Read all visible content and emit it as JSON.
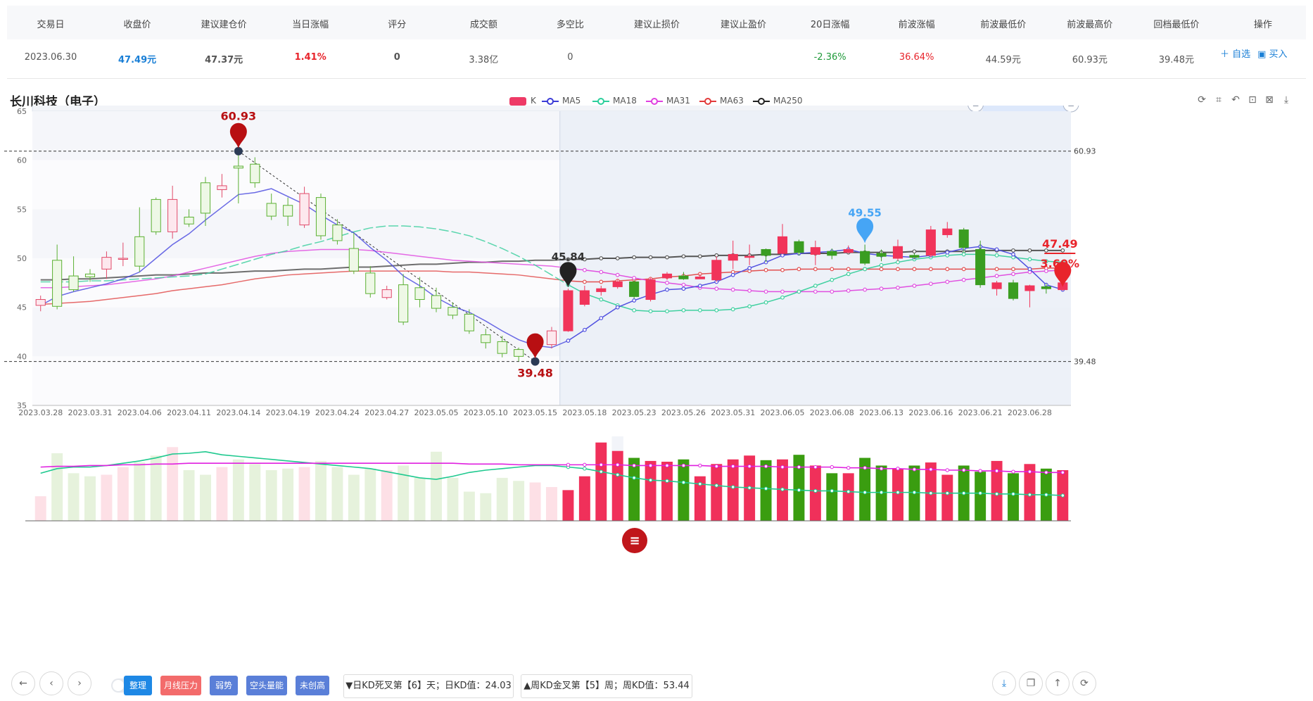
{
  "summary": {
    "headers": [
      "交易日",
      "收盘价",
      "建议建仓价",
      "当日涨幅",
      "评分",
      "成交额",
      "多空比",
      "建议止损价",
      "建议止盈价",
      "20日涨幅",
      "前波涨幅",
      "前波最低价",
      "前波最高价",
      "回档最低价",
      "操作"
    ],
    "values": [
      "2023.06.30",
      "47.49元",
      "47.37元",
      "1.41%",
      "0",
      "3.38亿",
      "0",
      "",
      "",
      "-2.36%",
      "36.64%",
      "44.59元",
      "60.93元",
      "39.48元"
    ],
    "ops": [
      "＋ 自选",
      "▣ 买入"
    ]
  },
  "stock_title": "长川科技（电子）",
  "legend": [
    {
      "name": "K",
      "color": "#ee3a66"
    },
    {
      "name": "MA5",
      "color": "#3b3bd6"
    },
    {
      "name": "MA18",
      "color": "#2ccf9c"
    },
    {
      "name": "MA31",
      "color": "#e040e0"
    },
    {
      "name": "MA63",
      "color": "#e23a3a"
    },
    {
      "name": "MA250",
      "color": "#222222"
    }
  ],
  "toolbox_icons": [
    "refresh-icon",
    "crop-icon",
    "undo-icon",
    "zoom-icon",
    "close-icon",
    "download-icon"
  ],
  "chart_data": {
    "type": "candlestick",
    "title": "长川科技（电子）",
    "ylim": [
      35,
      65
    ],
    "yticks": [
      35,
      40,
      45,
      50,
      55,
      60,
      65
    ],
    "x_labels": [
      "2023.03.28",
      "2023.03.31",
      "2023.04.06",
      "2023.04.11",
      "2023.04.14",
      "2023.04.19",
      "2023.04.24",
      "2023.04.27",
      "2023.05.05",
      "2023.05.10",
      "2023.05.15",
      "2023.05.18",
      "2023.05.23",
      "2023.05.26",
      "2023.05.31",
      "2023.06.05",
      "2023.06.08",
      "2023.06.13",
      "2023.06.16",
      "2023.06.21",
      "2023.06.28"
    ],
    "ohlc": [
      [
        45.2,
        45.8,
        44.6,
        46.2
      ],
      [
        49.8,
        45.1,
        44.8,
        51.4
      ],
      [
        48.2,
        46.8,
        46.6,
        50.2
      ],
      [
        48.4,
        48.1,
        47.6,
        48.9
      ],
      [
        48.9,
        50.1,
        47.9,
        50.7
      ],
      [
        50.0,
        50.0,
        49.2,
        51.6
      ],
      [
        52.2,
        49.2,
        48.6,
        55.2
      ],
      [
        56.0,
        52.7,
        52.4,
        56.2
      ],
      [
        52.7,
        56.0,
        52.0,
        57.4
      ],
      [
        54.2,
        53.5,
        53.2,
        55.0
      ],
      [
        57.7,
        54.6,
        53.3,
        58.3
      ],
      [
        57.0,
        57.4,
        56.2,
        58.6
      ],
      [
        59.4,
        59.2,
        55.6,
        60.9
      ],
      [
        59.6,
        57.7,
        57.2,
        60.3
      ],
      [
        55.6,
        54.3,
        53.9,
        56.6
      ],
      [
        55.4,
        54.3,
        53.3,
        56.2
      ],
      [
        53.4,
        56.6,
        53.1,
        57.3
      ],
      [
        56.2,
        52.3,
        51.9,
        56.6
      ],
      [
        53.4,
        51.8,
        51.4,
        54.0
      ],
      [
        51.0,
        48.7,
        48.4,
        52.6
      ],
      [
        48.5,
        46.4,
        46.0,
        49.2
      ],
      [
        46.0,
        46.8,
        45.8,
        47.2
      ],
      [
        47.3,
        43.5,
        43.2,
        48.4
      ],
      [
        47.0,
        45.8,
        45.0,
        48.1
      ],
      [
        46.2,
        44.9,
        44.5,
        47.0
      ],
      [
        45.0,
        44.2,
        43.8,
        45.5
      ],
      [
        44.3,
        42.6,
        42.3,
        44.8
      ],
      [
        42.2,
        41.4,
        40.8,
        42.8
      ],
      [
        41.5,
        40.3,
        39.9,
        42.1
      ],
      [
        40.7,
        40.0,
        39.5,
        40.9
      ],
      [
        40.6,
        41.2,
        40.1,
        41.7
      ],
      [
        41.2,
        42.6,
        40.8,
        43.0
      ],
      [
        42.6,
        46.7,
        42.5,
        46.9
      ],
      [
        45.3,
        46.7,
        45.1,
        47.2
      ],
      [
        46.6,
        46.9,
        46.2,
        47.2
      ],
      [
        47.1,
        47.6,
        46.9,
        47.8
      ],
      [
        47.6,
        46.1,
        45.9,
        47.8
      ],
      [
        45.8,
        47.8,
        45.6,
        48.0
      ],
      [
        48.0,
        48.4,
        47.8,
        48.6
      ],
      [
        48.2,
        47.9,
        47.8,
        48.6
      ],
      [
        47.9,
        48.1,
        47.9,
        48.4
      ],
      [
        47.8,
        49.8,
        47.6,
        50.2
      ],
      [
        49.8,
        50.4,
        48.9,
        51.8
      ],
      [
        50.2,
        50.2,
        49.3,
        51.4
      ],
      [
        50.9,
        50.3,
        49.6,
        51.0
      ],
      [
        50.5,
        52.2,
        50.4,
        53.5
      ],
      [
        51.7,
        50.6,
        50.3,
        51.9
      ],
      [
        50.4,
        51.1,
        49.3,
        51.8
      ],
      [
        50.7,
        50.3,
        49.9,
        51.0
      ],
      [
        50.6,
        50.9,
        50.5,
        51.3
      ],
      [
        50.7,
        49.5,
        49.3,
        51.4
      ],
      [
        50.5,
        50.2,
        49.7,
        50.9
      ],
      [
        50.0,
        51.2,
        49.7,
        51.9
      ],
      [
        50.3,
        50.1,
        49.9,
        50.5
      ],
      [
        50.3,
        52.9,
        50.1,
        53.3
      ],
      [
        52.4,
        53.0,
        52.1,
        53.7
      ],
      [
        52.9,
        51.1,
        50.6,
        53.1
      ],
      [
        50.9,
        47.3,
        47.0,
        51.8
      ],
      [
        46.9,
        47.5,
        46.2,
        47.7
      ],
      [
        47.5,
        45.9,
        45.7,
        47.8
      ],
      [
        46.7,
        47.2,
        45.0,
        47.3
      ],
      [
        47.1,
        46.9,
        46.4,
        47.4
      ],
      [
        46.8,
        47.5,
        46.7,
        48.2
      ]
    ],
    "ma5": [
      45.2,
      46.1,
      46.6,
      47.0,
      47.4,
      47.9,
      48.6,
      50.0,
      51.4,
      52.5,
      53.9,
      55.2,
      56.5,
      56.7,
      57.1,
      56.3,
      55.5,
      54.4,
      53.4,
      52.6,
      51.1,
      49.8,
      48.2,
      47.2,
      46.0,
      45.1,
      44.5,
      43.6,
      42.6,
      41.7,
      41.1,
      40.9,
      41.6,
      42.7,
      43.9,
      45.0,
      45.7,
      46.3,
      46.8,
      46.9,
      47.2,
      47.6,
      48.3,
      49.0,
      49.6,
      50.3,
      50.5,
      50.6,
      50.7,
      50.9,
      50.5,
      50.3,
      50.2,
      50.1,
      50.3,
      50.6,
      51.0,
      51.2,
      50.9,
      50.4,
      48.9,
      47.3,
      46.8
    ],
    "ma18": [
      47.6,
      47.6,
      47.6,
      47.7,
      47.7,
      47.8,
      47.9,
      48.0,
      48.1,
      48.2,
      48.4,
      48.9,
      49.4,
      49.9,
      50.4,
      50.8,
      51.3,
      51.7,
      52.2,
      52.7,
      53.1,
      53.3,
      53.3,
      53.2,
      53.0,
      52.7,
      52.3,
      51.7,
      51.0,
      50.2,
      49.3,
      48.3,
      47.3,
      46.4,
      45.8,
      45.2,
      44.7,
      44.6,
      44.6,
      44.7,
      44.7,
      44.7,
      44.8,
      45.1,
      45.5,
      46.0,
      46.6,
      47.2,
      47.8,
      48.4,
      48.9,
      49.3,
      49.6,
      49.9,
      50.1,
      50.3,
      50.4,
      50.4,
      50.3,
      50.1,
      49.9,
      49.7,
      49.6
    ],
    "ma31": [
      47.0,
      47.0,
      47.1,
      47.2,
      47.3,
      47.5,
      47.7,
      47.9,
      48.2,
      48.6,
      49.0,
      49.4,
      49.8,
      50.2,
      50.5,
      50.7,
      50.8,
      50.9,
      50.9,
      50.9,
      50.8,
      50.6,
      50.4,
      50.2,
      50.0,
      49.8,
      49.7,
      49.6,
      49.5,
      49.4,
      49.3,
      49.2,
      49.0,
      48.8,
      48.6,
      48.3,
      48.0,
      47.7,
      47.5,
      47.3,
      47.0,
      46.9,
      46.8,
      46.7,
      46.6,
      46.6,
      46.6,
      46.6,
      46.6,
      46.7,
      46.8,
      46.9,
      47.0,
      47.2,
      47.4,
      47.6,
      47.8,
      48.0,
      48.2,
      48.4,
      48.6,
      48.7,
      48.8
    ],
    "ma63": [
      45.3,
      45.4,
      45.5,
      45.6,
      45.8,
      46.0,
      46.2,
      46.4,
      46.7,
      46.9,
      47.1,
      47.3,
      47.6,
      47.9,
      48.1,
      48.3,
      48.4,
      48.5,
      48.6,
      48.7,
      48.7,
      48.7,
      48.7,
      48.7,
      48.7,
      48.6,
      48.6,
      48.5,
      48.4,
      48.3,
      48.1,
      47.9,
      47.7,
      47.6,
      47.6,
      47.7,
      47.8,
      47.9,
      48.1,
      48.2,
      48.4,
      48.5,
      48.6,
      48.7,
      48.8,
      48.8,
      48.9,
      48.9,
      48.9,
      48.9,
      48.9,
      48.9,
      48.9,
      48.9,
      48.9,
      48.9,
      48.9,
      48.9,
      48.9,
      48.9,
      48.9,
      49.0,
      49.0
    ],
    "ma250": [
      47.8,
      47.8,
      47.9,
      47.9,
      48.0,
      48.1,
      48.2,
      48.3,
      48.3,
      48.4,
      48.5,
      48.5,
      48.6,
      48.7,
      48.7,
      48.8,
      48.9,
      48.9,
      49.0,
      49.1,
      49.1,
      49.2,
      49.3,
      49.4,
      49.4,
      49.5,
      49.6,
      49.6,
      49.7,
      49.7,
      49.8,
      49.8,
      49.9,
      49.9,
      50.0,
      50.0,
      50.1,
      50.1,
      50.1,
      50.2,
      50.2,
      50.3,
      50.3,
      50.3,
      50.4,
      50.4,
      50.5,
      50.5,
      50.5,
      50.6,
      50.6,
      50.6,
      50.6,
      50.7,
      50.7,
      50.7,
      50.7,
      50.8,
      50.8,
      50.8,
      50.8,
      50.8,
      50.8
    ],
    "volume": [
      0.32,
      0.88,
      0.62,
      0.58,
      0.6,
      0.7,
      0.76,
      0.85,
      0.96,
      0.66,
      0.6,
      0.7,
      0.8,
      0.74,
      0.66,
      0.68,
      0.7,
      0.78,
      0.7,
      0.6,
      0.68,
      0.66,
      0.72,
      0.56,
      0.9,
      0.56,
      0.38,
      0.36,
      0.56,
      0.52,
      0.5,
      0.44,
      0.4,
      0.58,
      1.02,
      0.91,
      0.82,
      0.78,
      0.77,
      0.8,
      0.58,
      0.74,
      0.8,
      0.85,
      0.79,
      0.8,
      0.86,
      0.72,
      0.62,
      0.62,
      0.82,
      0.72,
      0.68,
      0.72,
      0.76,
      0.6,
      0.72,
      0.64,
      0.78,
      0.62,
      0.74,
      0.68,
      0.66
    ],
    "vol_ma_green": [
      0.62,
      0.68,
      0.7,
      0.7,
      0.72,
      0.75,
      0.78,
      0.82,
      0.87,
      0.88,
      0.9,
      0.86,
      0.84,
      0.82,
      0.8,
      0.78,
      0.76,
      0.74,
      0.72,
      0.7,
      0.68,
      0.64,
      0.6,
      0.56,
      0.54,
      0.58,
      0.63,
      0.66,
      0.68,
      0.7,
      0.72,
      0.72,
      0.7,
      0.68,
      0.64,
      0.6,
      0.56,
      0.53,
      0.52,
      0.5,
      0.48,
      0.46,
      0.44,
      0.43,
      0.42,
      0.41,
      0.4,
      0.39,
      0.39,
      0.38,
      0.37,
      0.37,
      0.37,
      0.37,
      0.36,
      0.36,
      0.36,
      0.36,
      0.35,
      0.35,
      0.34,
      0.34,
      0.33
    ],
    "vol_ma_magenta": [
      0.7,
      0.71,
      0.71,
      0.72,
      0.72,
      0.73,
      0.73,
      0.74,
      0.74,
      0.75,
      0.75,
      0.75,
      0.75,
      0.75,
      0.75,
      0.75,
      0.75,
      0.75,
      0.75,
      0.75,
      0.75,
      0.75,
      0.75,
      0.75,
      0.75,
      0.75,
      0.74,
      0.74,
      0.74,
      0.73,
      0.73,
      0.73,
      0.73,
      0.73,
      0.73,
      0.73,
      0.72,
      0.72,
      0.72,
      0.72,
      0.72,
      0.71,
      0.71,
      0.71,
      0.71,
      0.7,
      0.7,
      0.7,
      0.7,
      0.69,
      0.69,
      0.68,
      0.68,
      0.67,
      0.67,
      0.66,
      0.66,
      0.65,
      0.65,
      0.64,
      0.64,
      0.63,
      0.63
    ],
    "split_index": 32,
    "annotations": [
      {
        "label": "60.93",
        "price": 60.93,
        "index": 12,
        "color": "#b80f12",
        "type": "high"
      },
      {
        "label": "39.48",
        "price": 39.48,
        "index": 30,
        "color": "#b80f12",
        "type": "low"
      },
      {
        "label": "45.84",
        "price": 45.84,
        "index": 32,
        "color": "#222222",
        "type": "mark"
      },
      {
        "label": "49.55",
        "price": 49.55,
        "index": 50,
        "color": "#46a5f5",
        "type": "mark"
      },
      {
        "label": "47.49",
        "price": 47.49,
        "index": 62,
        "color": "#e8242b",
        "type": "last"
      },
      {
        "label": "3.60%",
        "price": 47.49,
        "index": 62,
        "color": "#e8242b",
        "type": "pct"
      }
    ],
    "hlines": [
      {
        "value": 60.93,
        "label": "60.93"
      },
      {
        "value": 39.48,
        "label": "39.48"
      }
    ]
  },
  "bottom": {
    "nav_icons": [
      "←",
      "‹",
      "›"
    ],
    "tags": [
      {
        "label": "整理",
        "color": "#1e88e5"
      },
      {
        "label": "月线压力",
        "color": "#f36b6b"
      },
      {
        "label": "弱势",
        "color": "#5a7fd8"
      },
      {
        "label": "空头量能",
        "color": "#5a7fd8"
      },
      {
        "label": "未创高",
        "color": "#5a7fd8"
      }
    ],
    "info": [
      "▼日KD死叉第【6】天；日KD值：24.03",
      "▲周KD金叉第【5】周；周KD值：53.44"
    ],
    "menu_icon": "≡",
    "right_icons": [
      "⤓",
      "❐",
      "↑",
      "⟳"
    ]
  }
}
